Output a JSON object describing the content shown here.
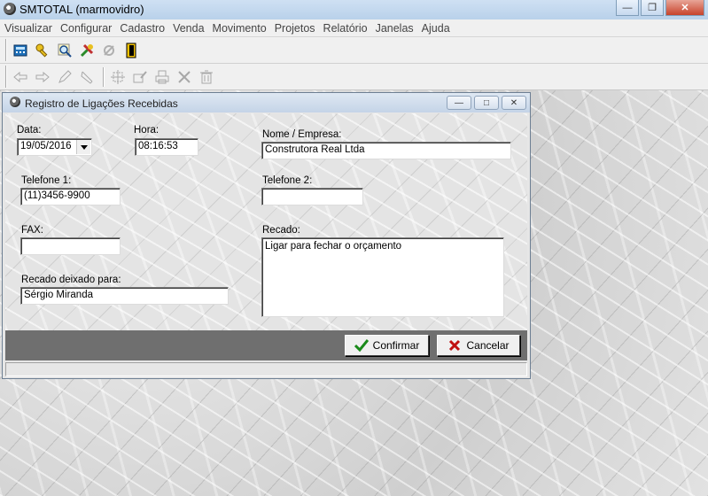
{
  "app": {
    "title": "SMTOTAL (marmovidro)"
  },
  "menu": [
    "Visualizar",
    "Configurar",
    "Cadastro",
    "Venda",
    "Movimento",
    "Projetos",
    "Relatório",
    "Janelas",
    "Ajuda"
  ],
  "dialog": {
    "title": "Registro de Ligações Recebidas",
    "fields": {
      "data": {
        "label": "Data:",
        "value": "19/05/2016"
      },
      "hora": {
        "label": "Hora:",
        "value": "08:16:53"
      },
      "nome": {
        "label": "Nome / Empresa:",
        "value": "Construtora Real Ltda"
      },
      "telefone1": {
        "label": "Telefone 1:",
        "value": "(11)3456-9900"
      },
      "telefone2": {
        "label": "Telefone 2:",
        "value": ""
      },
      "fax": {
        "label": "FAX:",
        "value": ""
      },
      "recado": {
        "label": "Recado:",
        "value": "Ligar para fechar o orçamento"
      },
      "recado_para": {
        "label": "Recado deixado para:",
        "value": "Sérgio Miranda"
      }
    },
    "buttons": {
      "confirm": "Confirmar",
      "cancel": "Cancelar"
    }
  },
  "colors": {
    "confirm_icon": "#1a8a1a",
    "cancel_icon": "#c01010",
    "button_bar": "#6f6f6f"
  }
}
